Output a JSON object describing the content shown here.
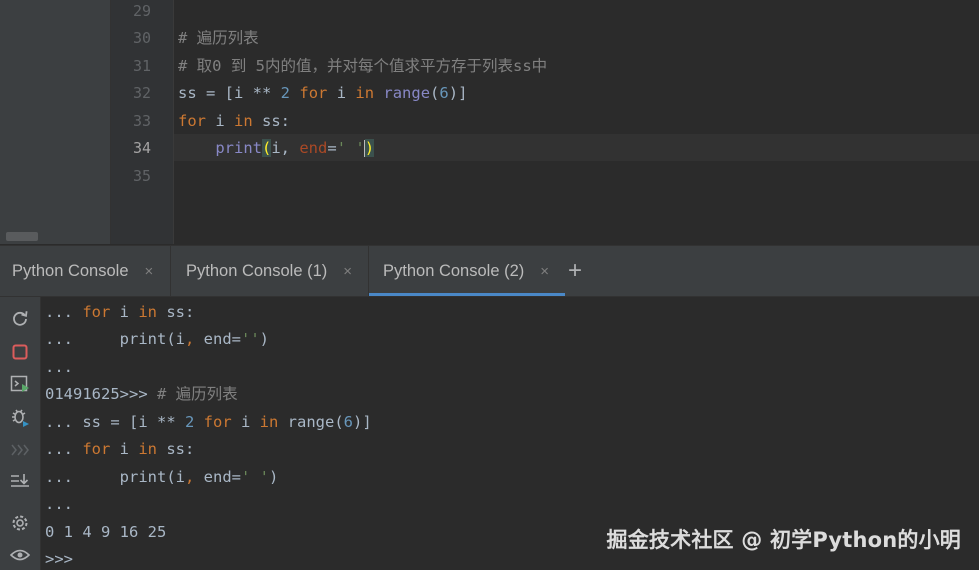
{
  "editor": {
    "line_numbers": [
      "29",
      "30",
      "31",
      "32",
      "33",
      "34",
      "35"
    ],
    "current_line": "34",
    "code": {
      "l30_comment": "# 遍历列表",
      "l31_comment": "# 取0 到 5内的值，并对每个值求平方存于列表ss中",
      "l32": {
        "a": "ss = [i ",
        "op": "**",
        "b": " ",
        "num": "2",
        "c": " ",
        "kw_for": "for",
        "d": " i ",
        "kw_in": "in",
        "e": " ",
        "fn": "range",
        "lp": "(",
        "arg": "6",
        "rp": ")]"
      },
      "l33": {
        "kw_for": "for",
        "a": " i ",
        "kw_in": "in",
        "b": " ss:"
      },
      "l34": {
        "indent": "    ",
        "fn": "print",
        "lp": "(",
        "a": "i, ",
        "param": "end",
        "eq": "=",
        "str": "' '",
        "rp": ")"
      }
    }
  },
  "tabs": [
    {
      "label": "Python Console",
      "close": "×"
    },
    {
      "label": "Python Console (1)",
      "close": "×"
    },
    {
      "label": "Python Console (2)",
      "close": "×"
    }
  ],
  "add_tab_icon": "+",
  "toolbar_icons": [
    "rerun-icon",
    "stop-icon",
    "run-console-icon",
    "debug-icon",
    "chevrons-icon",
    "scroll-end-icon",
    "settings-icon",
    "eye-icon"
  ],
  "console": {
    "line1": {
      "prompt": "... ",
      "kw_for": "for",
      "a": " i ",
      "kw_in": "in",
      "b": " ss:"
    },
    "line2": {
      "prompt": "...     ",
      "a": "print(i",
      "comma": ",",
      "b": " end=",
      "str": "''",
      "c": ")"
    },
    "line3": "...",
    "line4": {
      "out": "01491625>>> ",
      "comment": "# 遍历列表"
    },
    "line5": {
      "prompt": "... ",
      "a": "ss = [i ** ",
      "num": "2",
      "b": " ",
      "kw_for": "for",
      "c": " i ",
      "kw_in": "in",
      "d": " range(",
      "arg": "6",
      "e": ")]"
    },
    "line6": {
      "prompt": "... ",
      "kw_for": "for",
      "a": " i ",
      "kw_in": "in",
      "b": " ss:"
    },
    "line7": {
      "prompt": "...     ",
      "a": "print(i",
      "comma": ",",
      "b": " end=",
      "str": "' '",
      "c": ")"
    },
    "line8": "...",
    "line9": "0 1 4 9 16 25",
    "line10": ">>>"
  },
  "watermark": "掘金技术社区 @ 初学Python的小明",
  "colors": {
    "keyword": "#cc7832",
    "number": "#6897bb",
    "string": "#6a8759",
    "comment": "#808080",
    "builtin": "#8888c6",
    "accent": "#4a88c7"
  }
}
